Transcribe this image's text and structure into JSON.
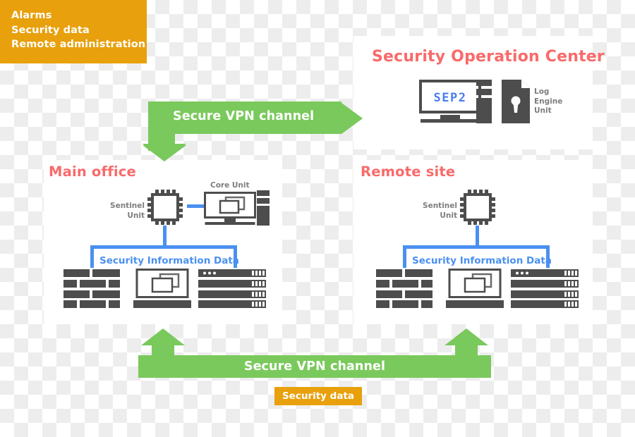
{
  "diagram": {
    "title": "Security Operation Center VPN architecture",
    "colors": {
      "green_arrow": "#7ac95c",
      "orange_box": "#e8a00c",
      "title_red": "#f96a6a",
      "link_blue": "#4a90f0",
      "device_gray": "#4d4d4d",
      "label_gray": "#7d7d7d",
      "panel_bg": "#ffffff"
    }
  },
  "info_box": {
    "lines": [
      "Alarms",
      "Security data",
      "Remote administration"
    ]
  },
  "vpn_top": {
    "label": "Secure VPN channel",
    "icon": "elbow-arrow-right-down"
  },
  "vpn_bottom": {
    "label": "Secure VPN channel",
    "icon": "double-headed-up-arrow",
    "badge": "Security data"
  },
  "soc": {
    "title": "Security Operation Center",
    "monitor_text": "SEP2",
    "devices": [
      {
        "name": "monitor",
        "label": "SEP2"
      },
      {
        "name": "server-tower",
        "label": ""
      },
      {
        "name": "log-document",
        "label": "Log\nEngine\nUnit"
      }
    ],
    "log_unit_lines": [
      "Log",
      "Engine",
      "Unit"
    ]
  },
  "main_office": {
    "title": "Main office",
    "sentinel_lines": [
      "Sentinel",
      "Unit"
    ],
    "core_unit_label": "Core Unit",
    "data_label": "Security Information Data",
    "devices": [
      "firewall",
      "workstation",
      "server-rack"
    ]
  },
  "remote_site": {
    "title": "Remote site",
    "sentinel_lines": [
      "Sentinel",
      "Unit"
    ],
    "data_label": "Security Information Data",
    "devices": [
      "firewall",
      "workstation",
      "server-rack"
    ]
  }
}
